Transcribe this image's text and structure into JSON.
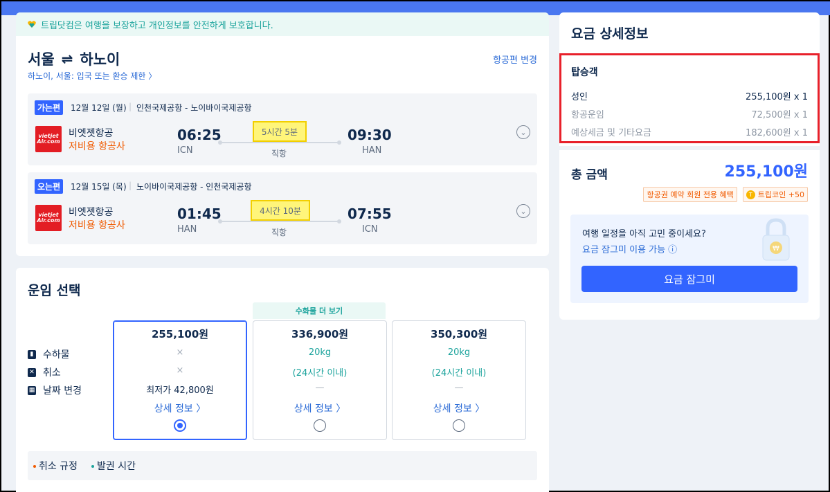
{
  "notice": "트립닷컴은 여행을 보장하고 개인정보를 안전하게 보호합니다.",
  "route": {
    "from": "서울",
    "swap_symbol": "⇌",
    "to": "하노이",
    "change_label": "항공편 변경",
    "restriction": "하노이, 서울: 입국 또는 환승 제한 〉"
  },
  "legs": [
    {
      "tag": "가는편",
      "date": "12월 12일 (월)",
      "airports": "인천국제공항 - 노이바이국제공항",
      "airline": "비엣젯항공",
      "airline_type": "저비용 항공사",
      "dep_time": "06:25",
      "dep_code": "ICN",
      "duration": "5시간 5분",
      "stops": "직항",
      "arr_time": "09:30",
      "arr_code": "HAN"
    },
    {
      "tag": "오는편",
      "date": "12월 15일 (목)",
      "airports": "노이바이국제공항 - 인천국제공항",
      "airline": "비엣젯항공",
      "airline_type": "저비용 항공사",
      "dep_time": "01:45",
      "dep_code": "HAN",
      "duration": "4시간 10분",
      "stops": "직항",
      "arr_time": "07:55",
      "arr_code": "ICN"
    }
  ],
  "fare": {
    "title": "운임 선택",
    "features": [
      "수하물",
      "취소",
      "날짜 변경"
    ],
    "more_bag": "수화물 더 보기",
    "options": [
      {
        "price": "255,100원",
        "baggage": "×",
        "cancel": "×",
        "change": "최저가 42,800원",
        "detail": "상세 정보 〉",
        "selected": true
      },
      {
        "price": "336,900원",
        "baggage": "20kg",
        "cancel": "(24시간 이내)",
        "change": "—",
        "detail": "상세 정보 〉",
        "selected": false
      },
      {
        "price": "350,300원",
        "baggage": "20kg",
        "cancel": "(24시간 이내)",
        "change": "—",
        "detail": "상세 정보 〉",
        "selected": false
      }
    ],
    "rules": [
      "취소 규정",
      "발권 시간"
    ]
  },
  "fee": {
    "title": "요금 상세정보",
    "pax_title": "탑승객",
    "rows": [
      {
        "label": "성인",
        "value": "255,100원 x 1"
      },
      {
        "label": "항공운임",
        "value": "72,500원 x 1"
      },
      {
        "label": "예상세금 및 기타요금",
        "value": "182,600원 x 1"
      }
    ],
    "total_label": "총 금액",
    "total_value": "255,100원",
    "badge_member": "항공권 예약 회원 전용 혜택",
    "badge_coin": "트립코인 +50",
    "lock_question": "여행 일정을 아직 고민 중이세요?",
    "lock_link": "요금 잠그미 이용 가능 ⓘ",
    "lock_button": "요금 잠그미"
  },
  "colors": {
    "accent": "#3264ff",
    "teal": "#1ba39c",
    "orange": "#f05a00",
    "highlight_yellow": "#fff57a",
    "highlight_red": "#e8202a"
  }
}
